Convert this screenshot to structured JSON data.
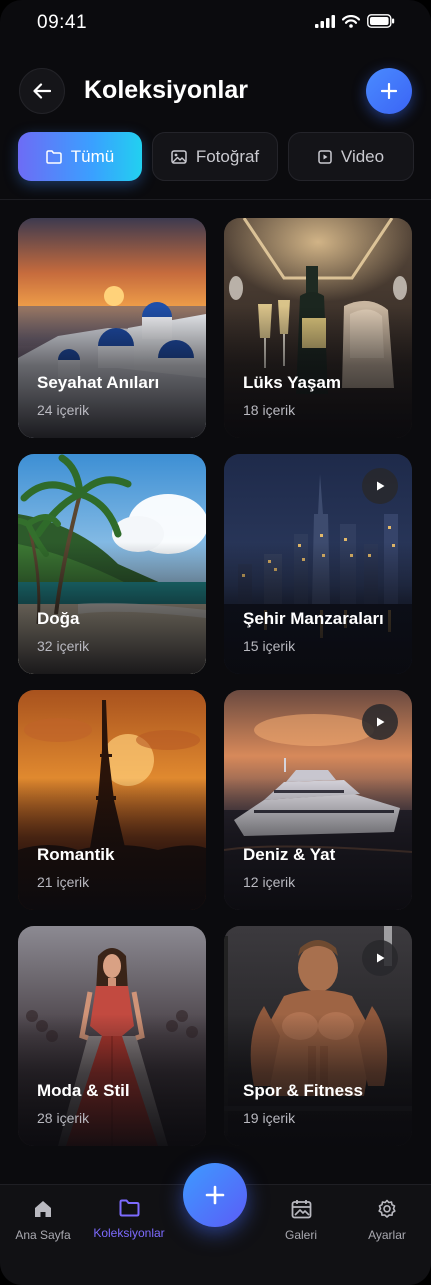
{
  "status_bar": {
    "time": "09:41"
  },
  "header": {
    "title": "Koleksiyonlar"
  },
  "tabs": [
    {
      "label": "Tümü",
      "icon": "folder-icon",
      "active": true
    },
    {
      "label": "Fotoğraf",
      "icon": "image-icon",
      "active": false
    },
    {
      "label": "Video",
      "icon": "video-icon",
      "active": false
    }
  ],
  "collections": [
    {
      "title": "Seyahat Anıları",
      "count": "24 içerik",
      "image": "santorini-sunset",
      "video": false
    },
    {
      "title": "Lüks Yaşam",
      "count": "18 içerik",
      "image": "private-jet-champagne",
      "video": false
    },
    {
      "title": "Doğa",
      "count": "32 içerik",
      "image": "tropical-beach-palms",
      "video": false
    },
    {
      "title": "Şehir Manzaraları",
      "count": "15 içerik",
      "image": "city-skyline-night",
      "video": true
    },
    {
      "title": "Romantik",
      "count": "21 içerik",
      "image": "eiffel-tower-sunset",
      "video": false
    },
    {
      "title": "Deniz & Yat",
      "count": "12 içerik",
      "image": "yacht-sunset",
      "video": true
    },
    {
      "title": "Moda & Stil",
      "count": "28 içerik",
      "image": "runway-red-dress",
      "video": false
    },
    {
      "title": "Spor & Fitness",
      "count": "19 içerik",
      "image": "gym-athlete",
      "video": true
    }
  ],
  "bottom_nav": {
    "items": [
      {
        "label": "Ana Sayfa",
        "icon": "home-icon",
        "active": false
      },
      {
        "label": "Koleksiyonlar",
        "icon": "folder-icon",
        "active": true
      },
      {
        "label": "Galeri",
        "icon": "gallery-icon",
        "active": false
      },
      {
        "label": "Ayarlar",
        "icon": "gear-icon",
        "active": false
      }
    ]
  },
  "colors": {
    "background": "#0b0b0e",
    "accent_blue": "#3b64f5",
    "accent_violet": "#7d6bff",
    "tab_gradient_start": "#6d6cf5",
    "tab_gradient_end": "#22d0f0"
  }
}
